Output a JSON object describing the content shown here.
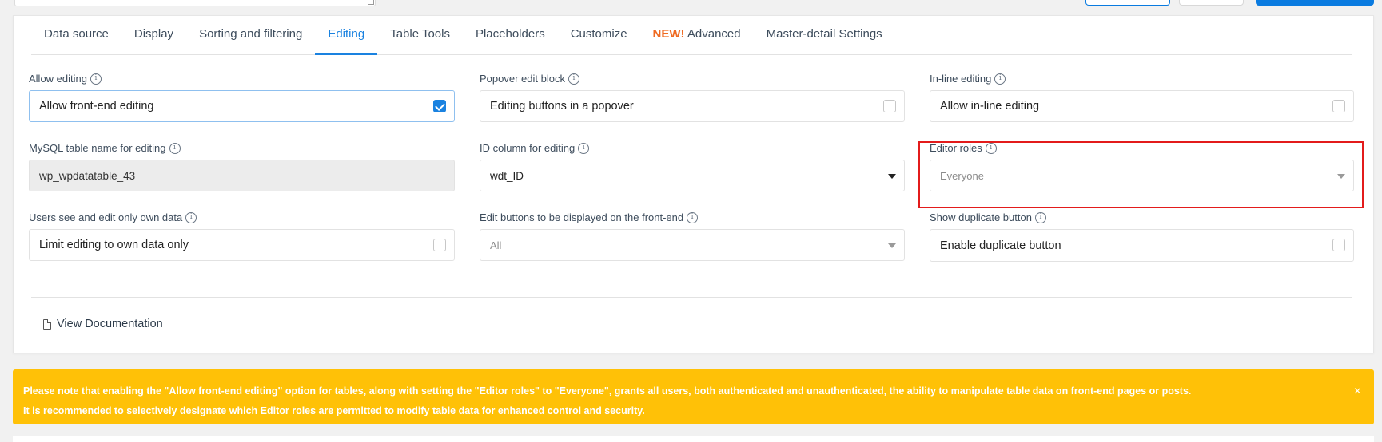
{
  "tabs": [
    {
      "label": "Data source"
    },
    {
      "label": "Display"
    },
    {
      "label": "Sorting and filtering"
    },
    {
      "label": "Editing"
    },
    {
      "label": "Table Tools"
    },
    {
      "label": "Placeholders"
    },
    {
      "label": "Customize"
    },
    {
      "new_badge": "NEW!",
      "label": "Advanced"
    },
    {
      "label": "Master-detail Settings"
    }
  ],
  "active_tab": "Editing",
  "fields": {
    "allow_editing": {
      "label": "Allow editing",
      "value": "Allow front-end editing",
      "checked": true
    },
    "popover_edit": {
      "label": "Popover edit block",
      "value": "Editing buttons in a popover",
      "checked": false
    },
    "inline_editing": {
      "label": "In-line editing",
      "value": "Allow in-line editing",
      "checked": false
    },
    "mysql_table": {
      "label": "MySQL table name for editing",
      "value": "wp_wpdatatable_43"
    },
    "id_column": {
      "label": "ID column for editing",
      "value": "wdt_ID"
    },
    "editor_roles": {
      "label": "Editor roles",
      "placeholder": "Everyone"
    },
    "own_data": {
      "label": "Users see and edit only own data",
      "value": "Limit editing to own data only",
      "checked": false
    },
    "edit_buttons": {
      "label": "Edit buttons to be displayed on the front-end",
      "placeholder": "All"
    },
    "duplicate": {
      "label": "Show duplicate button",
      "value": "Enable duplicate button",
      "checked": false
    }
  },
  "info_glyph": "i",
  "doc_link": "View Documentation",
  "notice": {
    "line1": "Please note that enabling the \"Allow front-end editing\" option for tables, along with setting the \"Editor roles\" to \"Everyone\", grants all users, both authenticated and unauthenticated, the ability to manipulate table data on front-end pages or posts.",
    "line2": "It is recommended to selectively designate which Editor roles are permitted to modify table data for enhanced control and security.",
    "close": "×"
  },
  "colors": {
    "accent": "#1a82e0",
    "new_badge": "#ef6a21",
    "warning": "#ffc107",
    "highlight": "#e31b1b"
  }
}
